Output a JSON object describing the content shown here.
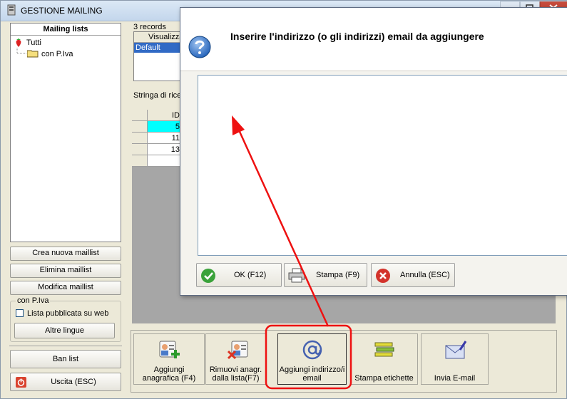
{
  "window": {
    "title": "GESTIONE MAILING"
  },
  "mailing_panel": {
    "header": "Mailing lists",
    "tree": [
      {
        "label": "Tutti"
      },
      {
        "label": "con P.Iva"
      }
    ],
    "buttons": {
      "create": "Crea nuova maillist",
      "delete": "Elimina maillist",
      "edit": "Modifica maillist"
    },
    "group": {
      "title": "con P.Iva",
      "checkbox_label": "Lista pubblicata su web",
      "other_langs": "Altre lingue"
    },
    "ban_list": "Ban list",
    "exit": "Uscita (ESC)"
  },
  "records": {
    "count_label": "3 records",
    "view_header": "Visualizza",
    "view_selected": "Default",
    "search_label": "Stringa di ricer",
    "id_header": "ID",
    "rows": [
      "5",
      "11",
      "13"
    ]
  },
  "toolbar": [
    {
      "line1": "Aggiungi",
      "line2": "anagrafica (F4)",
      "icon": "add-contact-icon"
    },
    {
      "line1": "Rimuovi anagr.",
      "line2": "dalla lista(F7)",
      "icon": "remove-contact-icon"
    },
    {
      "line1": "Aggiungi indirizzo/i",
      "line2": "email",
      "icon": "at-sign-icon"
    },
    {
      "line1": "Stampa etichette",
      "line2": "",
      "icon": "labels-icon"
    },
    {
      "line1": "Invia E-mail",
      "line2": "",
      "icon": "envelope-icon"
    }
  ],
  "dialog": {
    "question": "Inserire l'indirizzo (o gli indirizzi) email da aggiungere",
    "buttons": {
      "ok": "OK (F12)",
      "print": "Stampa (F9)",
      "cancel": "Annulla (ESC)"
    }
  },
  "colors": {
    "selection": "#316ac5",
    "highlight_row": "#00ffff",
    "annotation": "#ff0000"
  }
}
